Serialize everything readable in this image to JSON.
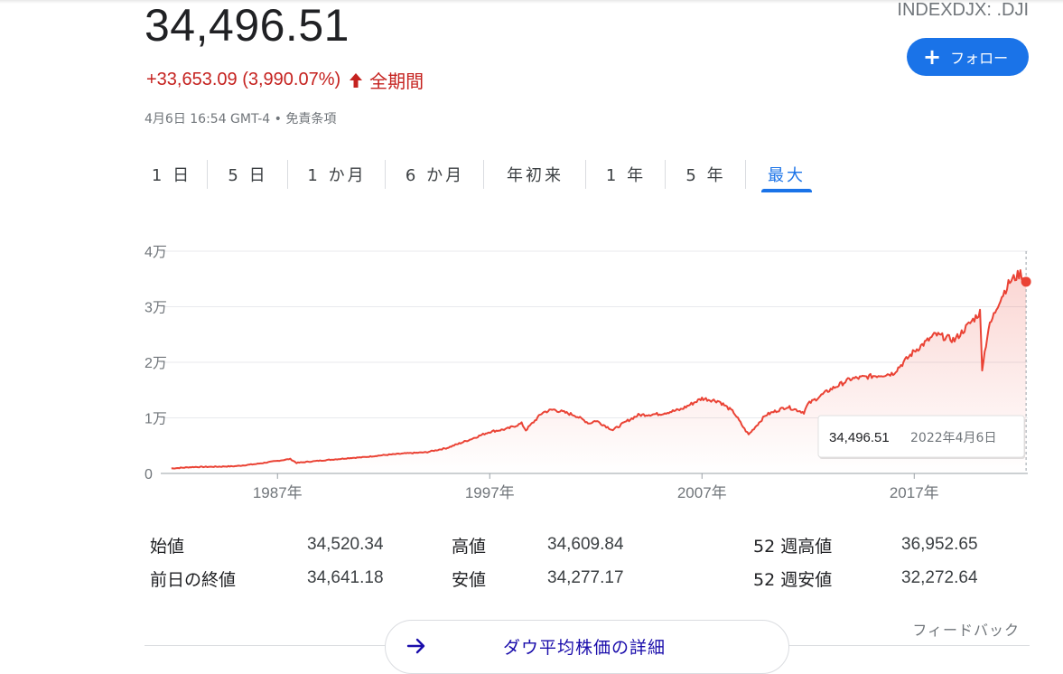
{
  "quote": {
    "price": "34,496.51",
    "ticker": "INDEXDJX: .DJI",
    "change": "+33,653.09 (3,990.07%)",
    "period": "全期間",
    "meta": "4月6日 16:54 GMT-4 • 免責条項",
    "follow_label": "フォロー"
  },
  "tabs": [
    {
      "label": "1 日",
      "active": false
    },
    {
      "label": "5 日",
      "active": false
    },
    {
      "label": "1 か月",
      "active": false
    },
    {
      "label": "6 か月",
      "active": false
    },
    {
      "label": "年初来",
      "active": false
    },
    {
      "label": "1 年",
      "active": false
    },
    {
      "label": "5 年",
      "active": false
    },
    {
      "label": "最大",
      "active": true
    }
  ],
  "colors": {
    "line": "#ea4335",
    "down_text": "#c5221f",
    "accent": "#1a73e8"
  },
  "chart_data": {
    "type": "area",
    "y_tick_labels": [
      "0",
      "1万",
      "2万",
      "3万",
      "4万"
    ],
    "y_tick_values": [
      0,
      10000,
      20000,
      30000,
      40000
    ],
    "x_tick_labels": [
      "1987年",
      "1997年",
      "2007年",
      "2017年"
    ],
    "x_tick_values": [
      1987,
      1997,
      2007,
      2017
    ],
    "ylim": [
      0,
      40000
    ],
    "xlim": [
      1981.5,
      2022.35
    ],
    "grid": true,
    "tooltip": {
      "value": "34,496.51",
      "date": "2022年4月6日"
    },
    "x": [
      1982.0,
      1983.0,
      1984.0,
      1985.0,
      1986.0,
      1987.6,
      1987.9,
      1989.0,
      1990.5,
      1991.0,
      1992.0,
      1993.0,
      1994.0,
      1995.0,
      1996.0,
      1997.0,
      1997.8,
      1998.5,
      1998.7,
      1999.5,
      2000.0,
      2001.0,
      2001.7,
      2002.0,
      2002.8,
      2003.5,
      2004.0,
      2005.0,
      2006.0,
      2007.0,
      2007.8,
      2008.5,
      2009.0,
      2009.2,
      2010.0,
      2011.0,
      2011.8,
      2012.0,
      2013.0,
      2014.0,
      2015.0,
      2016.0,
      2017.0,
      2018.0,
      2018.9,
      2019.5,
      2020.1,
      2020.2,
      2020.5,
      2021.0,
      2021.5,
      2022.0,
      2022.27
    ],
    "y": [
      900,
      1150,
      1200,
      1300,
      1700,
      2600,
      1900,
      2300,
      2800,
      2900,
      3300,
      3600,
      3800,
      4600,
      6000,
      7500,
      8000,
      9000,
      7800,
      11000,
      11500,
      10500,
      9000,
      9500,
      7800,
      9500,
      10500,
      10700,
      11500,
      13500,
      13000,
      11000,
      8000,
      7000,
      10500,
      12000,
      11000,
      12500,
      15000,
      17000,
      17500,
      18000,
      22000,
      25000,
      24000,
      26500,
      29000,
      19000,
      26000,
      31000,
      34500,
      36000,
      34500
    ]
  },
  "stats": {
    "left": [
      {
        "label": "始値",
        "value": "34,520.34"
      },
      {
        "label": "前日の終値",
        "value": "34,641.18"
      }
    ],
    "mid": [
      {
        "label": "高値",
        "value": "34,609.84"
      },
      {
        "label": "安値",
        "value": "34,277.17"
      }
    ],
    "right": [
      {
        "label": "52 週高値",
        "value": "36,952.65"
      },
      {
        "label": "52 週安値",
        "value": "32,272.64"
      }
    ]
  },
  "feedback_label": "フィードバック",
  "details_label": "ダウ平均株価の詳細"
}
